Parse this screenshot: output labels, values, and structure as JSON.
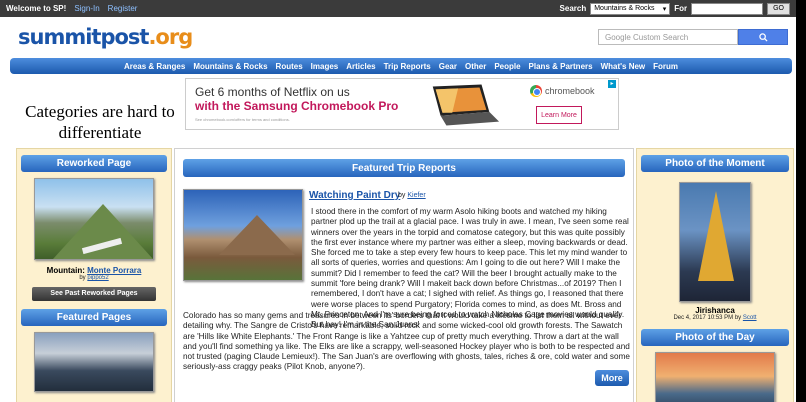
{
  "topbar": {
    "welcome": "Welcome to SP!",
    "signin": "Sign-In",
    "register": "Register",
    "search_label": "Search",
    "search_select": "Mountains & Rocks",
    "for_label": "For",
    "go": "GO"
  },
  "header": {
    "logo_main": "summitpost",
    "logo_tld": ".org",
    "search_placeholder": "Google Custom Search"
  },
  "nav": [
    "Areas & Ranges",
    "Mountains & Rocks",
    "Routes",
    "Images",
    "Articles",
    "Trip Reports",
    "Gear",
    "Other",
    "People",
    "Plans & Partners",
    "What's New",
    "Forum"
  ],
  "annotation": "Categories are hard to differentiate",
  "ad": {
    "line1": "Get 6 months of Netflix on us",
    "line2": "with the Samsung Chromebook Pro",
    "small": "See chromebook.com/offers for terms and conditions.",
    "brand": "chromebook",
    "cta": "Learn More"
  },
  "left": {
    "reworked_title": "Reworked Page",
    "mountain_label": "Mountain:",
    "mountain_name": "Monte Porrara",
    "by": "by",
    "author": "pippo52",
    "past_button": "See Past Reworked Pages",
    "featured_title": "Featured Pages"
  },
  "middle": {
    "title": "Featured Trip Reports",
    "report_title": "Watching Paint Dry",
    "by": "by",
    "report_author": "Kiefer",
    "para1": "I stood there in the comfort of my warm Asolo hiking boots and watched my hiking partner plod up the trail at a glacial pace. I was truly in awe. I mean, I've seen some real winners over the years in the torpid and comatose category, but this was quite possibly the first ever instance where my partner was either a sleep, moving backwards or dead. She forced me to take a step every few hours to keep pace. This let my mind wander to all sorts of queries, worries and questions: Am I going to die out here? Will I make the summit? Did I remember to feed the cat? Will the beer I brought actually make to the summit 'fore being drank? Will I makeit back down before Christmas...of 2019? Then I remembered, I don't have a cat; I sighed with relief. As things go, I reasoned that there were worse places to spend Purgatory; Florida comes to mind, as does Mt. Bross and Mt. Princeton. And I'm sure being forced to watch Nicholas Cage movies would qualify. But hey! I'm in the San Juans!",
    "para2": "Colorado has so many gems and treasures in between its' borders that it would take a lifetime to list them all without ever detailing why. The Sangre de Cristo's have remarkable, solid rock and some wicked-cool old growth forests. The Sawatch are 'Hills like White Elephants.' The Front Range is like a Yahtzee cup of pretty much everything. Throw a dart at the wall and you'll find something ya like. The Elks are like a scrappy, well-seasoned Hockey player who is both to be respected and not trusted (paging Claude Lemieux!). The San Juan's are overflowing with ghosts, tales, riches & ore, cold water and some seriously-ass craggy peaks (Pilot Knob, anyone?).",
    "more": "More"
  },
  "right": {
    "photo_title": "Photo of the Moment",
    "photo_name": "Jirishanca",
    "photo_date": "Dec 4, 2017 10:53 PM",
    "by": "by",
    "photo_author": "Scott",
    "day_title": "Photo of the Day"
  }
}
